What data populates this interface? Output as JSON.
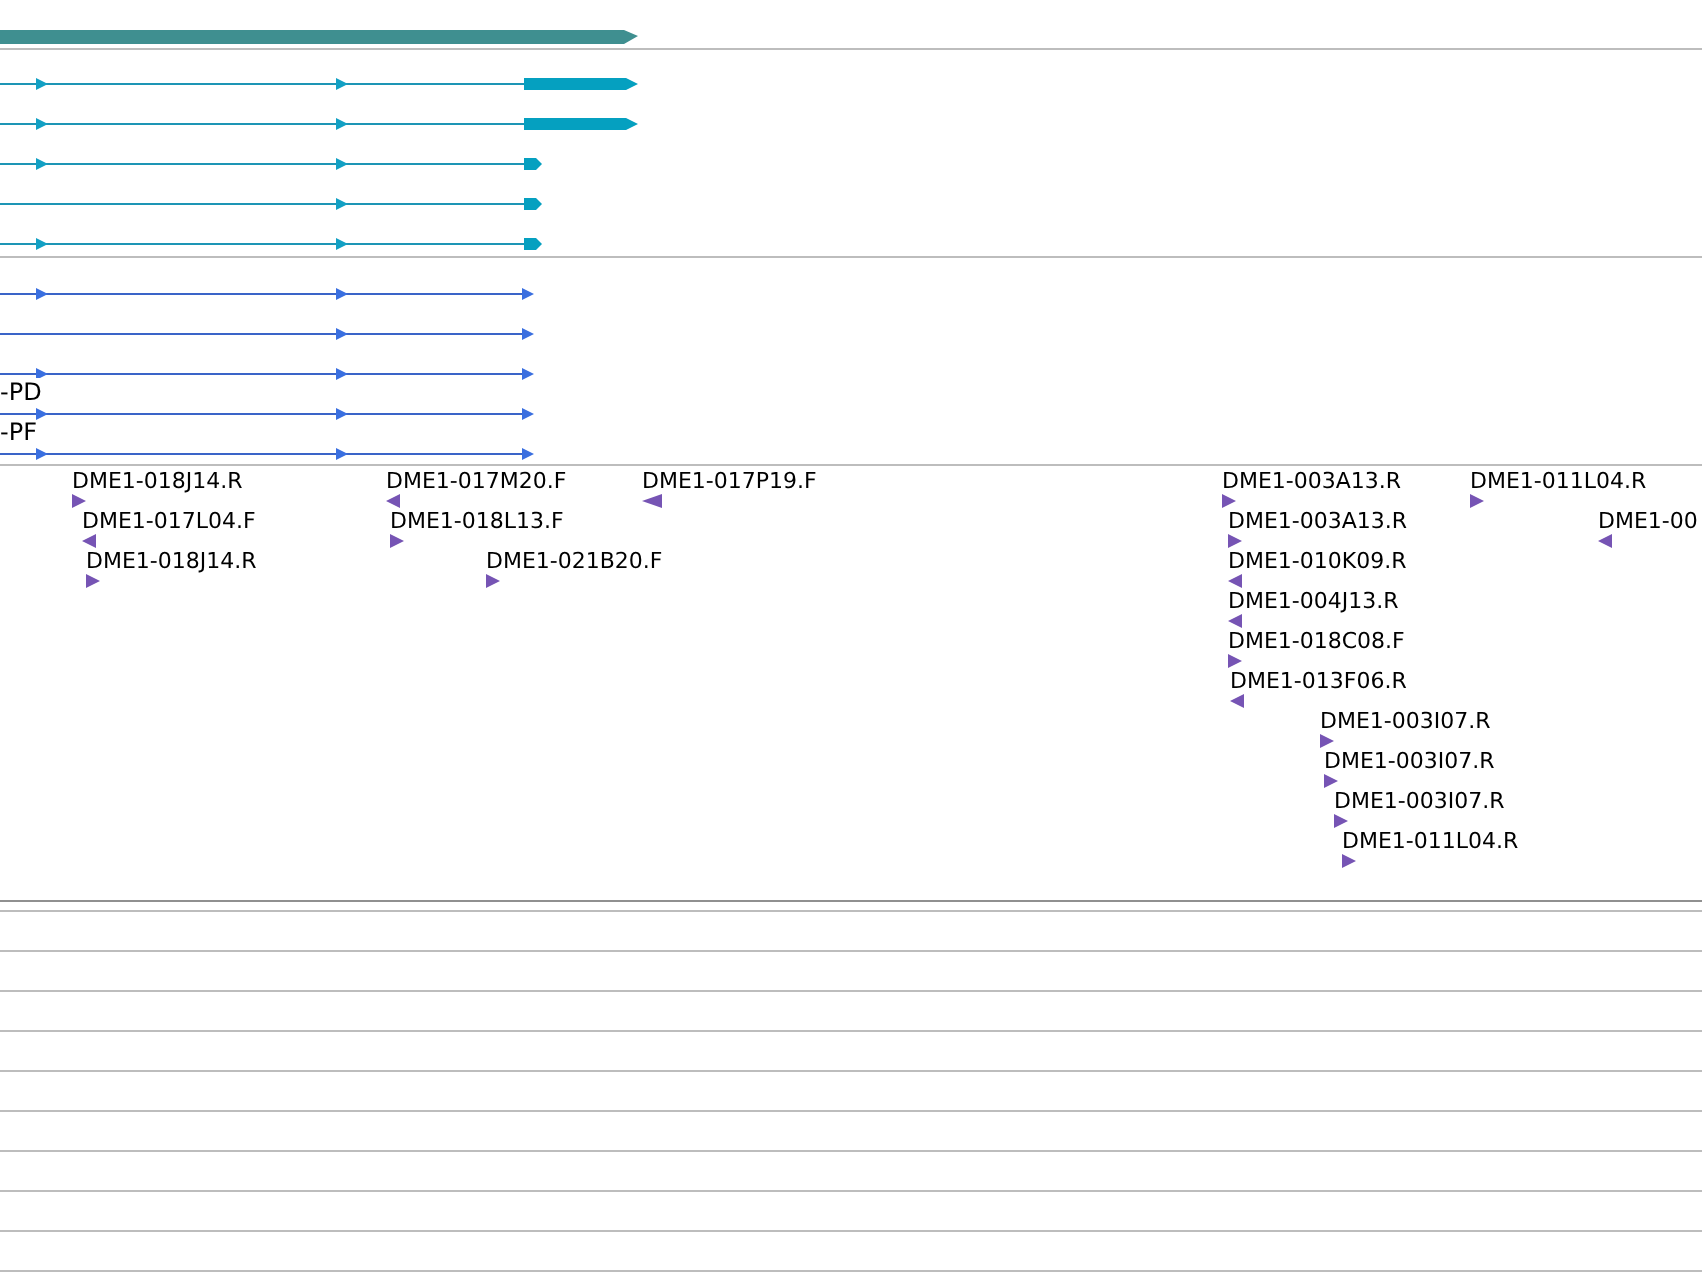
{
  "gene": {
    "forward": true
  },
  "transcripts_a": [
    {
      "thick_end": true
    },
    {
      "thick_end": true
    },
    {
      "thick_end": false
    },
    {
      "thick_end": false
    },
    {
      "thick_end": false
    }
  ],
  "transcripts_b": [
    {
      "forward": true
    },
    {
      "forward": true
    },
    {
      "forward": true
    },
    {
      "forward": true,
      "label": "-PD"
    },
    {
      "forward": true,
      "label": "-PF"
    }
  ],
  "clones": [
    {
      "label": "DME1-018J14.R",
      "forward": true
    },
    {
      "label": "DME1-017L04.F",
      "forward": false
    },
    {
      "label": "DME1-018J14.R",
      "forward": true
    },
    {
      "label": "DME1-017M20.F",
      "forward": false
    },
    {
      "label": "DME1-018L13.F",
      "forward": true
    },
    {
      "label": "DME1-021B20.F",
      "forward": true
    },
    {
      "label": "DME1-017P19.F",
      "forward": false
    },
    {
      "label": "DME1-003A13.R",
      "forward": true
    },
    {
      "label": "DME1-003A13.R",
      "forward": true
    },
    {
      "label": "DME1-010K09.R",
      "forward": false
    },
    {
      "label": "DME1-004J13.R",
      "forward": false
    },
    {
      "label": "DME1-018C08.F",
      "forward": true
    },
    {
      "label": "DME1-013F06.R",
      "forward": false
    },
    {
      "label": "DME1-003I07.R",
      "forward": true
    },
    {
      "label": "DME1-003I07.R",
      "forward": true
    },
    {
      "label": "DME1-003I07.R",
      "forward": true
    },
    {
      "label": "DME1-011L04.R",
      "forward": true
    },
    {
      "label": "DME1-011L04.R",
      "forward": true
    },
    {
      "label": "DME1-00",
      "forward": false
    }
  ]
}
